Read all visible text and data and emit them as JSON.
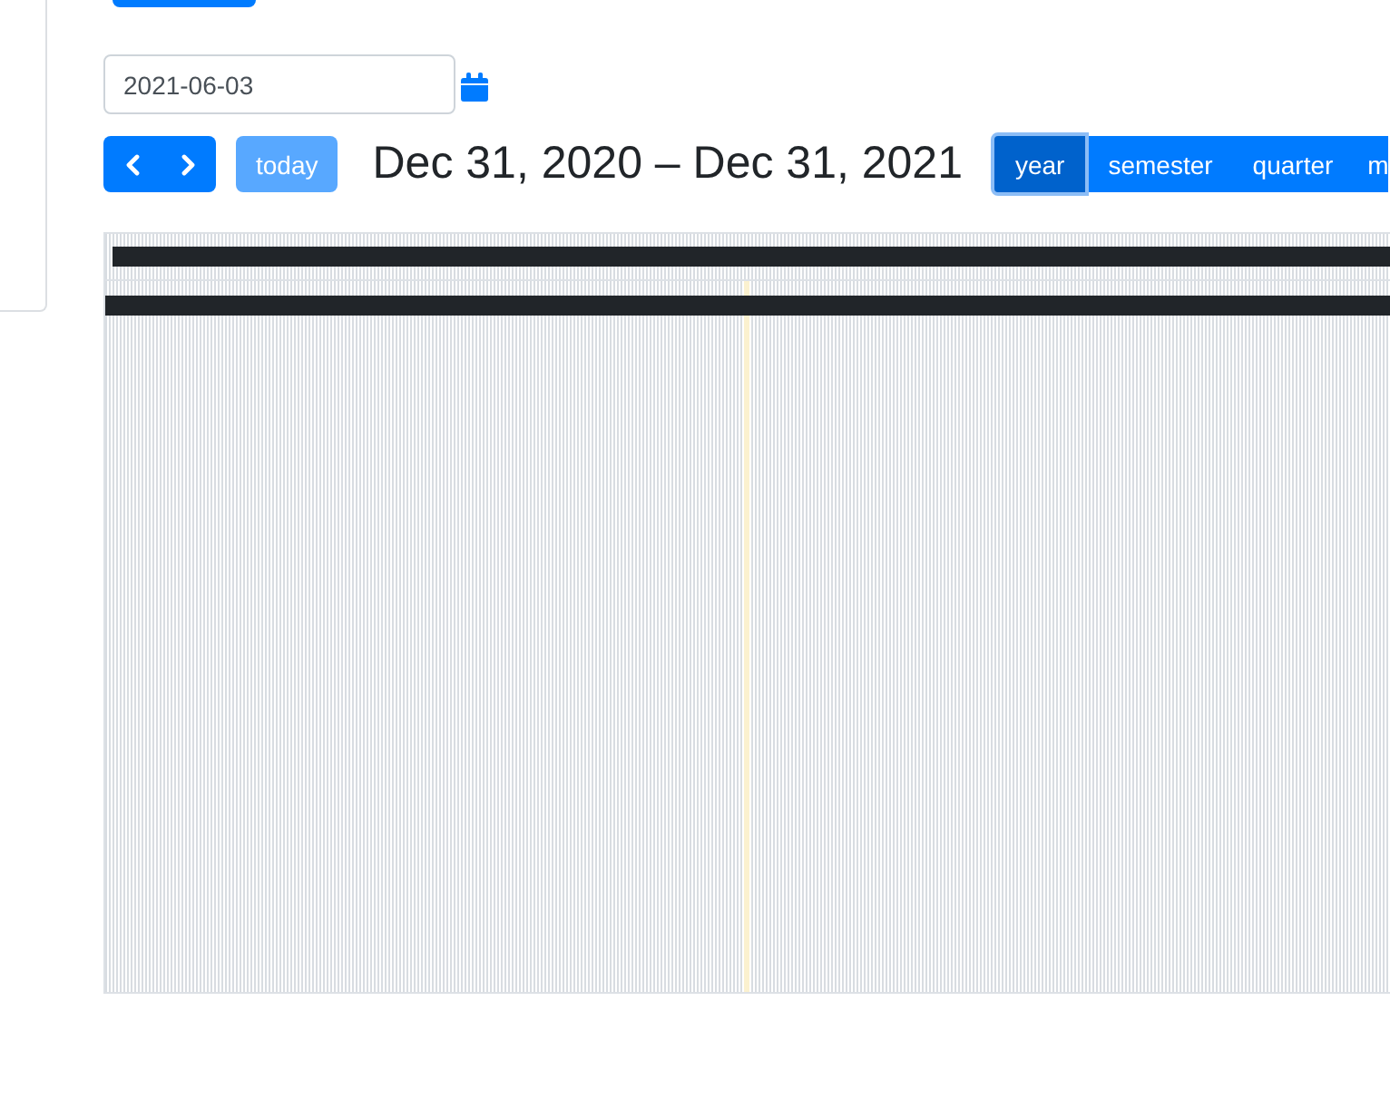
{
  "date_field": {
    "value": "2021-06-03"
  },
  "toolbar": {
    "nav_buttons": [
      {
        "kind": "prev"
      },
      {
        "kind": "next"
      }
    ],
    "today_button": {
      "label": "today",
      "disabled": true
    },
    "title": "Dec 31, 2020 – Dec 31, 2021",
    "views": [
      {
        "label": "year",
        "selected": true
      },
      {
        "label": "semester",
        "selected": false
      },
      {
        "label": "quarter",
        "selected": false
      },
      {
        "label": "m",
        "selected": false
      }
    ]
  }
}
